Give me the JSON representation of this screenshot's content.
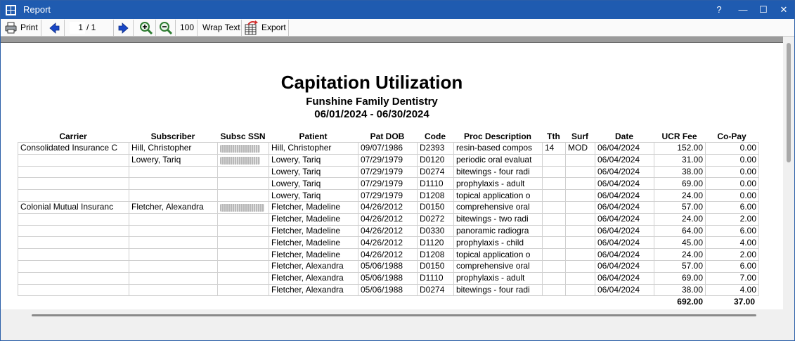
{
  "window": {
    "title": "Report",
    "help": "?",
    "minimize": "—",
    "maximize": "☐",
    "close": "✕"
  },
  "toolbar": {
    "print_label": "Print",
    "page_current": "1",
    "page_total": "/ 1",
    "zoom_level": "100",
    "wrap_label": "Wrap Text",
    "export_label": "Export"
  },
  "report": {
    "title": "Capitation Utilization",
    "practice": "Funshine Family Dentistry",
    "date_range": "06/01/2024 - 06/30/2024",
    "columns": [
      "Carrier",
      "Subscriber",
      "Subsc SSN",
      "Patient",
      "Pat DOB",
      "Code",
      "Proc Description",
      "Tth",
      "Surf",
      "Date",
      "UCR Fee",
      "Co-Pay"
    ],
    "rows": [
      [
        "Consolidated Insurance C",
        "Hill, Christopher",
        "",
        "Hill, Christopher",
        "09/07/1986",
        "D2393",
        "resin-based compos",
        "14",
        "MOD",
        "06/04/2024",
        "152.00",
        "0.00"
      ],
      [
        "",
        "Lowery, Tariq",
        "",
        "Lowery, Tariq",
        "07/29/1979",
        "D0120",
        "periodic oral evaluat",
        "",
        "",
        "06/04/2024",
        "31.00",
        "0.00"
      ],
      [
        "",
        "",
        "",
        "Lowery, Tariq",
        "07/29/1979",
        "D0274",
        "bitewings - four radi",
        "",
        "",
        "06/04/2024",
        "38.00",
        "0.00"
      ],
      [
        "",
        "",
        "",
        "Lowery, Tariq",
        "07/29/1979",
        "D1110",
        "prophylaxis - adult",
        "",
        "",
        "06/04/2024",
        "69.00",
        "0.00"
      ],
      [
        "",
        "",
        "",
        "Lowery, Tariq",
        "07/29/1979",
        "D1208",
        "topical application o",
        "",
        "",
        "06/04/2024",
        "24.00",
        "0.00"
      ],
      [
        "Colonial Mutual Insuranc",
        "Fletcher, Alexandra",
        "",
        "Fletcher, Madeline",
        "04/26/2012",
        "D0150",
        "comprehensive oral",
        "",
        "",
        "06/04/2024",
        "57.00",
        "6.00"
      ],
      [
        "",
        "",
        "",
        "Fletcher, Madeline",
        "04/26/2012",
        "D0272",
        "bitewings - two radi",
        "",
        "",
        "06/04/2024",
        "24.00",
        "2.00"
      ],
      [
        "",
        "",
        "",
        "Fletcher, Madeline",
        "04/26/2012",
        "D0330",
        "panoramic radiogra",
        "",
        "",
        "06/04/2024",
        "64.00",
        "6.00"
      ],
      [
        "",
        "",
        "",
        "Fletcher, Madeline",
        "04/26/2012",
        "D1120",
        "prophylaxis - child",
        "",
        "",
        "06/04/2024",
        "45.00",
        "4.00"
      ],
      [
        "",
        "",
        "",
        "Fletcher, Madeline",
        "04/26/2012",
        "D1208",
        "topical application o",
        "",
        "",
        "06/04/2024",
        "24.00",
        "2.00"
      ],
      [
        "",
        "",
        "",
        "Fletcher, Alexandra",
        "05/06/1988",
        "D0150",
        "comprehensive oral",
        "",
        "",
        "06/04/2024",
        "57.00",
        "6.00"
      ],
      [
        "",
        "",
        "",
        "Fletcher, Alexandra",
        "05/06/1988",
        "D1110",
        "prophylaxis - adult",
        "",
        "",
        "06/04/2024",
        "69.00",
        "7.00"
      ],
      [
        "",
        "",
        "",
        "Fletcher, Alexandra",
        "05/06/1988",
        "D0274",
        "bitewings - four radi",
        "",
        "",
        "06/04/2024",
        "38.00",
        "4.00"
      ]
    ],
    "total_ucr": "692.00",
    "total_copay": "37.00"
  },
  "colors": {
    "titlebar": "#1f5bb0",
    "toolbar_bg": "#fafafa",
    "zoom_icon": "#2e7d32",
    "nav_arrow": "#1947c6"
  }
}
